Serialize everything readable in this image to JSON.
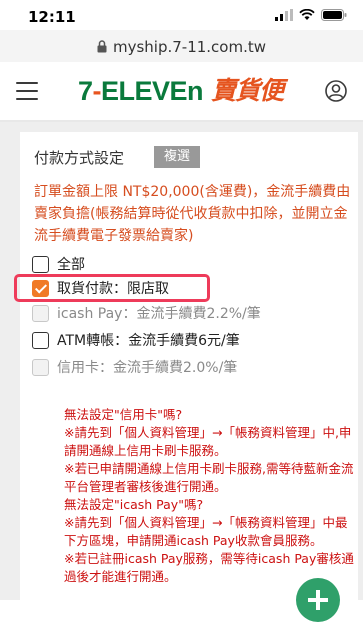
{
  "status_bar": {
    "time": "12:11"
  },
  "browser": {
    "url": "myship.7-11.com.tw"
  },
  "header": {
    "logo_brand_prefix": "7",
    "logo_brand_dash": "-",
    "logo_brand_suffix": "ELEVEn",
    "logo_subtitle": "賣貨便"
  },
  "payment": {
    "title": "付款方式設定",
    "copy_button": "複選",
    "notice": "訂單金額上限 NT$20,000(含運費)，金流手續費由賣家負擔(帳務結算時從代收貨款中扣除，並開立金流手續費電子發票給賣家)",
    "options": [
      {
        "label": "全部",
        "checked": false,
        "disabled": false
      },
      {
        "label": "取貨付款：限店取",
        "checked": true,
        "disabled": false
      },
      {
        "label": "icash Pay：金流手續費2.2%/筆",
        "checked": false,
        "disabled": true
      },
      {
        "label": "ATM轉帳：金流手續費6元/筆",
        "checked": false,
        "disabled": false
      },
      {
        "label": "信用卡：金流手續費2.0%/筆",
        "checked": false,
        "disabled": true
      }
    ],
    "help_lines": [
      "無法設定\"信用卡\"嗎?",
      "※請先到「個人資料管理」→「帳務資料管理」中,申請開通線上信用卡刷卡服務。",
      "※若已申請開通線上信用卡刷卡服務,需等待藍新金流平台管理者審核後進行開通。",
      "無法設定\"icash Pay\"嗎?",
      "※請先到「個人資料管理」→「帳務資料管理」中最下方區塊，申請開通icash Pay收款會員服務。",
      "※若已註冊icash Pay服務，需等待icash Pay審核通過後才能進行開通。"
    ]
  },
  "colors": {
    "brand_green": "#0a7a3c",
    "brand_orange": "#e5541f",
    "notice_orange": "#d64d1f",
    "help_red": "#cc1111",
    "highlight": "#ee3b5a",
    "fab_green": "#2fa06a"
  },
  "icons": [
    "signal-icon",
    "wifi-icon",
    "battery-icon",
    "lock-icon",
    "menu-icon",
    "user-icon",
    "add-icon"
  ]
}
